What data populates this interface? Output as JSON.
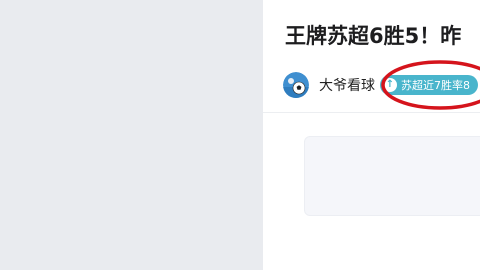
{
  "article": {
    "title": "王牌苏超6胜5！昨",
    "author": "大爷看球",
    "tag_label": "苏超近7胜率8"
  },
  "icons": {
    "tag_icon": "arrow-up-icon",
    "avatar": "soccer-ball-avatar"
  },
  "colors": {
    "page_background": "#e9ebef",
    "card_background": "#ffffff",
    "tag": "#49b5cc",
    "annotation": "#d5141c"
  }
}
